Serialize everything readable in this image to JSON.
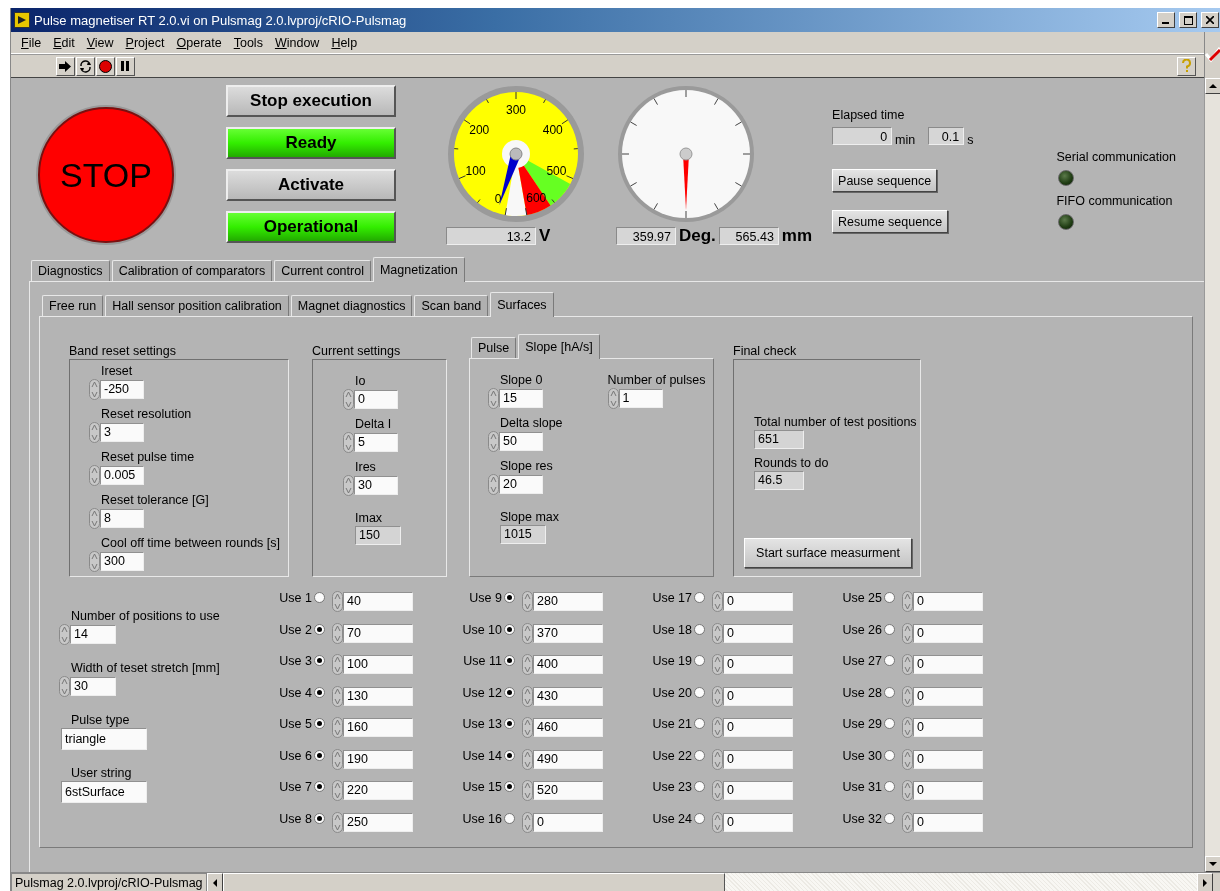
{
  "window": {
    "title": "Pulse magnetiser RT 2.0.vi on Pulsmag 2.0.lvproj/cRIO-Pulsmag"
  },
  "menu": [
    "File",
    "Edit",
    "View",
    "Project",
    "Operate",
    "Tools",
    "Window",
    "Help"
  ],
  "stop_button": {
    "label": "STOP"
  },
  "buttons": [
    {
      "label": "Stop execution",
      "on": false
    },
    {
      "label": "Ready",
      "on": true
    },
    {
      "label": "Activate",
      "on": false
    },
    {
      "label": "Operational",
      "on": true
    }
  ],
  "gauges": [
    {
      "kind": "dial",
      "scale": [
        "0",
        "100",
        "200",
        "300",
        "400",
        "500",
        "600"
      ],
      "readouts": [
        {
          "value": "13.2",
          "unit": "V"
        }
      ]
    },
    {
      "kind": "compass",
      "readouts": [
        {
          "value": "359.97",
          "unit": "Deg."
        },
        {
          "value": "565.43",
          "unit": "mm"
        }
      ]
    }
  ],
  "elapsed_time": {
    "label": "Elapsed time",
    "fields": [
      {
        "value": "0",
        "unit": "min"
      },
      {
        "value": "0.1",
        "unit": "s"
      }
    ]
  },
  "sequence_buttons": [
    "Pause sequence",
    "Resume sequence"
  ],
  "indicators": [
    {
      "label": "Serial communication",
      "on": false
    },
    {
      "label": "FIFO communication",
      "on": false
    }
  ],
  "tabs": [
    {
      "label": "Diagnostics",
      "selected": false
    },
    {
      "label": "Calibration of comparators",
      "selected": false
    },
    {
      "label": "Current control",
      "selected": false
    },
    {
      "label": "Magnetization",
      "selected": true
    }
  ],
  "subtabs": [
    {
      "label": "Free run",
      "selected": false
    },
    {
      "label": "Hall sensor position calibration",
      "selected": false
    },
    {
      "label": "Magnet diagnostics",
      "selected": false
    },
    {
      "label": "Scan band",
      "selected": false
    },
    {
      "label": "Surfaces",
      "selected": true
    }
  ],
  "band_reset_settings": {
    "title": "Band reset settings",
    "fields": [
      {
        "label": "Ireset",
        "value": "-250",
        "kind": "control"
      },
      {
        "label": "Reset resolution",
        "value": "3",
        "kind": "control"
      },
      {
        "label": "Reset pulse time",
        "value": "0.005",
        "kind": "control"
      },
      {
        "label": "Reset tolerance [G]",
        "value": "8",
        "kind": "control"
      },
      {
        "label": "Cool off time between rounds [s]",
        "value": "300",
        "kind": "control"
      }
    ]
  },
  "current_settings": {
    "title": "Current settings",
    "fields": [
      {
        "label": "Io",
        "value": "0",
        "kind": "control"
      },
      {
        "label": "Delta I",
        "value": "5",
        "kind": "control"
      },
      {
        "label": "Ires",
        "value": "30",
        "kind": "control"
      },
      {
        "label": "Imax",
        "value": "150",
        "kind": "indicator"
      }
    ]
  },
  "pulse_tabs": {
    "tabs": [
      {
        "label": "Pulse",
        "selected": false
      },
      {
        "label": "Slope [hA/s]",
        "selected": true
      }
    ],
    "fields": [
      {
        "label": "Slope 0",
        "value": "15",
        "kind": "control"
      },
      {
        "label": "Delta slope",
        "value": "50",
        "kind": "control"
      },
      {
        "label": "Slope res",
        "value": "20",
        "kind": "control"
      },
      {
        "label": "Slope max",
        "value": "1015",
        "kind": "indicator"
      }
    ],
    "side_fields": [
      {
        "label": "Number of pulses",
        "value": "1",
        "kind": "control"
      }
    ]
  },
  "final_check": {
    "title": "Final check",
    "fields": [
      {
        "label": "Total number of test positions",
        "value": "651",
        "kind": "indicator"
      },
      {
        "label": "Rounds to do",
        "value": "46.5",
        "kind": "indicator"
      }
    ],
    "button": "Start surface measurment"
  },
  "position_settings": [
    {
      "label": "Number of positions to use",
      "value": "14",
      "kind": "control"
    },
    {
      "label": "Width of teset stretch [mm]",
      "value": "30",
      "kind": "control"
    },
    {
      "label": "Pulse type",
      "value": "triangle",
      "kind": "string"
    },
    {
      "label": "User string",
      "value": "6stSurface",
      "kind": "string"
    }
  ],
  "positions": [
    {
      "label": "Use 1",
      "checked": false,
      "value": "40"
    },
    {
      "label": "Use 2",
      "checked": true,
      "value": "70"
    },
    {
      "label": "Use 3",
      "checked": true,
      "value": "100"
    },
    {
      "label": "Use 4",
      "checked": true,
      "value": "130"
    },
    {
      "label": "Use 5",
      "checked": true,
      "value": "160"
    },
    {
      "label": "Use 6",
      "checked": true,
      "value": "190"
    },
    {
      "label": "Use 7",
      "checked": true,
      "value": "220"
    },
    {
      "label": "Use 8",
      "checked": true,
      "value": "250"
    },
    {
      "label": "Use 9",
      "checked": true,
      "value": "280"
    },
    {
      "label": "Use 10",
      "checked": true,
      "value": "370"
    },
    {
      "label": "Use 11",
      "checked": true,
      "value": "400"
    },
    {
      "label": "Use 12",
      "checked": true,
      "value": "430"
    },
    {
      "label": "Use 13",
      "checked": true,
      "value": "460"
    },
    {
      "label": "Use 14",
      "checked": true,
      "value": "490"
    },
    {
      "label": "Use 15",
      "checked": true,
      "value": "520"
    },
    {
      "label": "Use 16",
      "checked": false,
      "value": "0"
    },
    {
      "label": "Use 17",
      "checked": false,
      "value": "0"
    },
    {
      "label": "Use 18",
      "checked": false,
      "value": "0"
    },
    {
      "label": "Use 19",
      "checked": false,
      "value": "0"
    },
    {
      "label": "Use 20",
      "checked": false,
      "value": "0"
    },
    {
      "label": "Use 21",
      "checked": false,
      "value": "0"
    },
    {
      "label": "Use 22",
      "checked": false,
      "value": "0"
    },
    {
      "label": "Use 23",
      "checked": false,
      "value": "0"
    },
    {
      "label": "Use 24",
      "checked": false,
      "value": "0"
    },
    {
      "label": "Use 25",
      "checked": false,
      "value": "0"
    },
    {
      "label": "Use 26",
      "checked": false,
      "value": "0"
    },
    {
      "label": "Use 27",
      "checked": false,
      "value": "0"
    },
    {
      "label": "Use 28",
      "checked": false,
      "value": "0"
    },
    {
      "label": "Use 29",
      "checked": false,
      "value": "0"
    },
    {
      "label": "Use 30",
      "checked": false,
      "value": "0"
    },
    {
      "label": "Use 31",
      "checked": false,
      "value": "0"
    },
    {
      "label": "Use 32",
      "checked": false,
      "value": "0"
    }
  ],
  "status_bar": {
    "path": "Pulsmag 2.0.lvproj/cRIO-Pulsmag"
  }
}
